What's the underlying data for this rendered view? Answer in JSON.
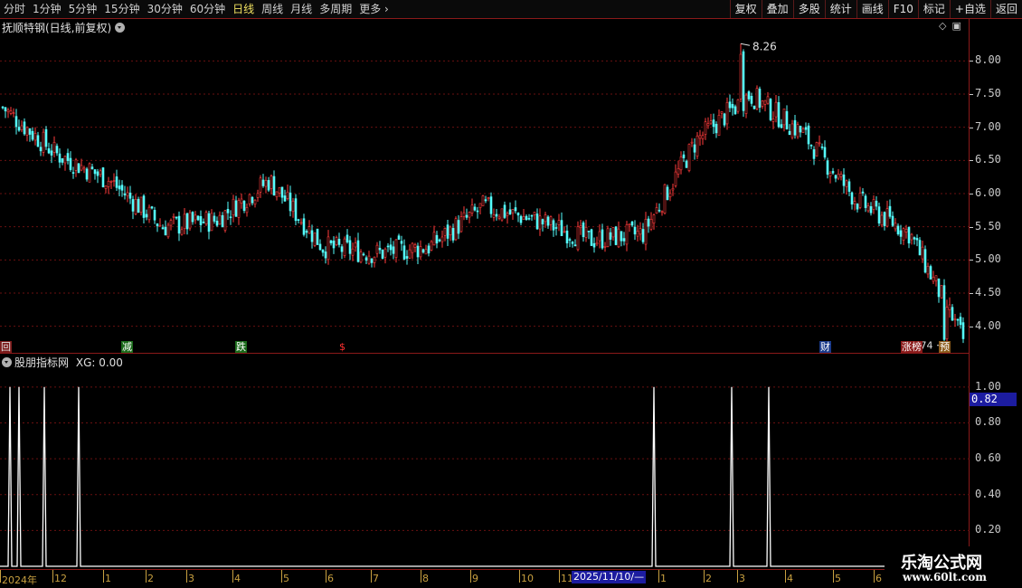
{
  "toolbar": {
    "periods": [
      {
        "label": "分时",
        "active": false
      },
      {
        "label": "1分钟",
        "active": false
      },
      {
        "label": "5分钟",
        "active": false
      },
      {
        "label": "15分钟",
        "active": false
      },
      {
        "label": "30分钟",
        "active": false
      },
      {
        "label": "60分钟",
        "active": false
      },
      {
        "label": "日线",
        "active": true
      },
      {
        "label": "周线",
        "active": false
      },
      {
        "label": "月线",
        "active": false
      },
      {
        "label": "多周期",
        "active": false
      },
      {
        "label": "更多",
        "active": false
      }
    ],
    "buttons": [
      "复权",
      "叠加",
      "多股",
      "统计",
      "画线",
      "F10",
      "标记",
      "+自选",
      "返回"
    ]
  },
  "main_panel": {
    "title": "抚顺特钢(日线,前复权)",
    "high_label": "8.26",
    "low_label": "3.74",
    "y_axis": [
      "8.00",
      "7.50",
      "7.00",
      "6.50",
      "6.00",
      "5.50",
      "5.00",
      "4.50",
      "4.00"
    ],
    "events": [
      {
        "label": "回",
        "color": "#e0e0e0",
        "bg": "#7a1a1a"
      },
      {
        "label": "减",
        "color": "#ffffff",
        "bg": "#1a6a1a"
      },
      {
        "label": "跌",
        "color": "#ffffff",
        "bg": "#1a6a1a"
      },
      {
        "label": "$",
        "color": "#ff3030",
        "bg": "transparent"
      },
      {
        "label": "财",
        "color": "#ffffff",
        "bg": "#1a3a8a"
      },
      {
        "label": "涨榜",
        "color": "#ffffff",
        "bg": "#8a1a1a"
      },
      {
        "label": "预",
        "color": "#ffffff",
        "bg": "#8a5a1a"
      }
    ]
  },
  "indicator_panel": {
    "title": "股朋指标网",
    "xg_text": "XG: 0.00",
    "y_axis": [
      "1.00",
      "0.80",
      "0.60",
      "0.40",
      "0.20"
    ],
    "current_value": "0.82"
  },
  "date_axis": [
    "2024年",
    "12",
    "1",
    "2",
    "3",
    "4",
    "5",
    "6",
    "7",
    "8",
    "9",
    "10",
    "11",
    "1",
    "2",
    "3",
    "4",
    "5",
    "6"
  ],
  "cursor_date": "2025/11/10/—",
  "watermark": {
    "title": "乐淘公式网",
    "url": "www.60lt.com"
  },
  "chart_data": [
    {
      "type": "candlestick",
      "title": "抚顺特钢(日线,前复权)",
      "ylim": [
        3.6,
        8.4
      ],
      "price_high": 8.26,
      "price_low": 3.74,
      "x": [
        "2024-11",
        "2024-12",
        "2025-01",
        "2025-02",
        "2025-03",
        "2025-04",
        "2025-05",
        "2025-06",
        "2025-07",
        "2025-08",
        "2025-09",
        "2025-10",
        "2025-11",
        "2026-01",
        "2026-02",
        "2026-03",
        "2026-04",
        "2026-05",
        "2026-06"
      ],
      "close_approx": [
        7.3,
        6.6,
        6.2,
        5.5,
        5.6,
        6.2,
        5.2,
        5.1,
        5.2,
        5.8,
        5.6,
        5.3,
        5.4,
        6.8,
        7.5,
        6.9,
        5.9,
        5.4,
        3.8
      ],
      "up_color": "#ff3c3c",
      "down_color": "#54fcfc"
    },
    {
      "type": "line",
      "title": "股朋指标网",
      "series": [
        {
          "name": "XG",
          "values": [
            0,
            1,
            1,
            1,
            1,
            0,
            0,
            0,
            0,
            0,
            0,
            0,
            0,
            1,
            0,
            1,
            1,
            0,
            0
          ]
        }
      ],
      "ylim": [
        0,
        1.1
      ],
      "color": "#ffffff"
    }
  ]
}
